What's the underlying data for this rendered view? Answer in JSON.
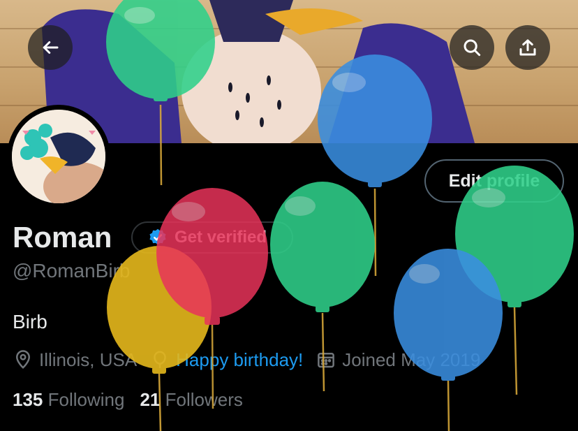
{
  "header": {
    "back_icon": "arrow-left-icon",
    "search_icon": "search-icon",
    "share_icon": "share-icon"
  },
  "profile": {
    "name": "Roman",
    "handle": "@RomanBirb",
    "bio": "Birb",
    "edit_profile_label": "Edit profile",
    "get_verified_label": "Get verified",
    "location": "Illinois, USA",
    "birthday_text": "Happy birthday!",
    "joined": "Joined May 2019",
    "following_count": "135",
    "following_label": "Following",
    "followers_count": "21",
    "followers_label": "Followers"
  },
  "colors": {
    "background": "#000000",
    "accent": "#1d9bf0",
    "muted": "#71767b",
    "balloon_green": "#2fd08a",
    "balloon_blue": "#3a8ee0",
    "balloon_red": "#e8335a",
    "balloon_yellow": "#e5b81c"
  }
}
